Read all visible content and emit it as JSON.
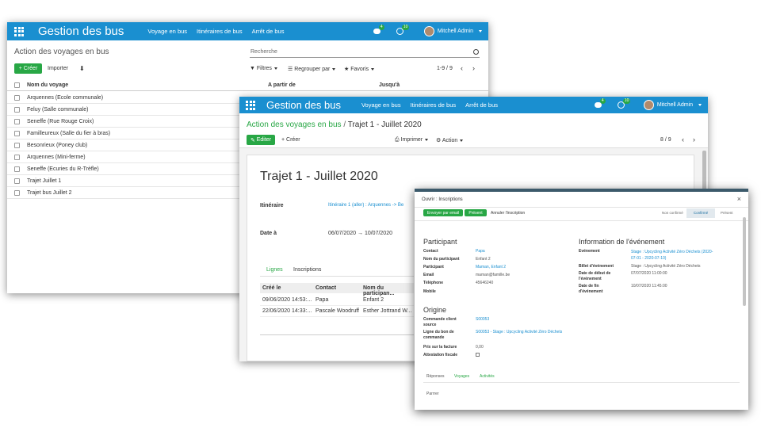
{
  "window1": {
    "app_title": "Gestion des bus",
    "menu": [
      "Voyage en bus",
      "Itinéraires de bus",
      "Arrêt de bus"
    ],
    "badge_messages": "4",
    "badge_activities": "10",
    "user": "Mitchell Admin",
    "page_title": "Action des voyages en bus",
    "search_placeholder": "Recherche",
    "create_label": "Créer",
    "import_label": "Importer",
    "filters_label": "Filtres",
    "groupby_label": "Regrouper par",
    "favorites_label": "Favoris",
    "pager": "1-9 / 9",
    "columns": [
      "Nom du voyage",
      "A partir de",
      "Jusqu'à"
    ],
    "rows": [
      "Arquennes (Ecole communale)",
      "Feluy (Salle communale)",
      "Seneffe (Rue Rouge Croix)",
      "Familleureux (Salle du fier à bras)",
      "Besonrieux (Poney club)",
      "Arquennes (Mini-ferme)",
      "Seneffe (Ecuries du R-Trèfle)",
      "Trajet Juillet 1",
      "Trajet bus Juillet 2"
    ]
  },
  "window2": {
    "app_title": "Gestion des bus",
    "menu": [
      "Voyage en bus",
      "Itinéraires de bus",
      "Arrêt de bus"
    ],
    "badge_messages": "4",
    "badge_activities": "10",
    "user": "Mitchell Admin",
    "breadcrumb_parent": "Action des voyages en bus",
    "breadcrumb_sep": "/",
    "breadcrumb_current": "Trajet 1 - Juillet 2020",
    "edit_label": "Editer",
    "create_label": "Créer",
    "print_label": "Imprimer",
    "action_label": "Action",
    "pager": "8 / 9",
    "record_title": "Trajet 1 - Juillet 2020",
    "itinerary_label": "Itinéraire",
    "itinerary_value": "Itinéraire 1 (aller) : Arquennes -> Be",
    "date_label": "Date à",
    "date_from": "06/07/2020",
    "date_arrow": "→",
    "date_to": "10/07/2020",
    "tabs": [
      "Lignes",
      "Inscriptions"
    ],
    "table_columns": [
      "Créé le",
      "Contact",
      "Nom du participan..."
    ],
    "table_rows": [
      [
        "09/06/2020 14:53:...",
        "Papa",
        "Enfant 2"
      ],
      [
        "22/06/2020 14:33:...",
        "Pascale Woodruff",
        "Esther Jottrand W..."
      ]
    ]
  },
  "modal": {
    "title": "Ouvrir : Inscriptions",
    "close": "×",
    "send_email_label": "Envoyer par email",
    "present_label": "Présent",
    "cancel_label": "Annuler l'inscription",
    "status_steps": [
      "Non confirmé",
      "Confirmé",
      "Présent"
    ],
    "participant_title": "Participant",
    "participant_fields": [
      {
        "label": "Contact",
        "value": "Papa"
      },
      {
        "label": "Nom du participant",
        "value": "Enfant 2"
      },
      {
        "label": "Participant",
        "value": "Maman, Enfant 2"
      },
      {
        "label": "Email",
        "value": "maman@famille.be"
      },
      {
        "label": "Téléphone",
        "value": "45646240"
      },
      {
        "label": "Mobile",
        "value": ""
      }
    ],
    "event_title": "Information de l'événement",
    "event_fields": [
      {
        "label": "Evénement",
        "value": "Stage : Upcycling Activité Zéro Déchets (2020-07-01 - 2020-07-10)"
      },
      {
        "label": "Billet d'événement",
        "value": "Stage : Upcycling Activité Zéro Déchets"
      },
      {
        "label": "Date de début de l'événement",
        "value": "07/07/2020 11:00:00"
      },
      {
        "label": "Date de fin d'événement",
        "value": "10/07/2020 11:45:00"
      }
    ],
    "origin_title": "Origine",
    "origin_fields": [
      {
        "label": "Commande client source",
        "value": "S00053"
      },
      {
        "label": "Ligne du bon de commande",
        "value": "S00053 - Stage : Upcycling Activité Zéro Déchets"
      },
      {
        "label": "Prix sur la facture",
        "value": "0,00"
      },
      {
        "label": "Attestation fiscale",
        "value": ""
      }
    ],
    "bottom_tabs": [
      "Réponses",
      "Voyages",
      "Activités"
    ],
    "bottom_item": "Parrrer"
  },
  "colors": {
    "brand": "#1a8fd0",
    "accent_green": "#28a745",
    "modal_header": "#3c5a6b"
  }
}
